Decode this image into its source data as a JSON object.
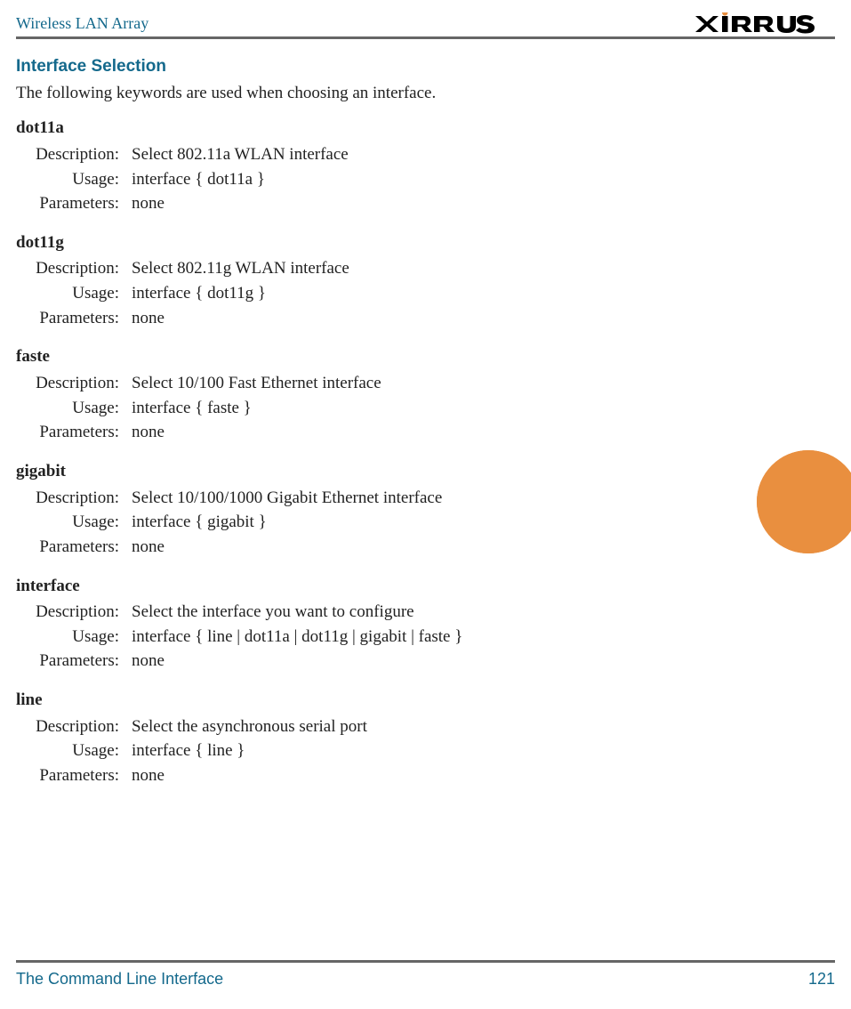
{
  "header": {
    "title": "Wireless LAN Array",
    "brand": "XIRRUS"
  },
  "section": {
    "heading": "Interface Selection",
    "intro": "The following keywords are used when choosing an interface."
  },
  "labels": {
    "description": "Description:",
    "usage": "Usage:",
    "parameters": "Parameters:"
  },
  "keywords": [
    {
      "name": "dot11a",
      "description": "Select 802.11a WLAN interface",
      "usage": "interface { dot11a }",
      "parameters": "none"
    },
    {
      "name": "dot11g",
      "description": "Select 802.11g WLAN interface",
      "usage": "interface { dot11g }",
      "parameters": "none"
    },
    {
      "name": "faste",
      "description": "Select 10/100 Fast Ethernet interface",
      "usage": "interface { faste }",
      "parameters": "none"
    },
    {
      "name": "gigabit",
      "description": "Select 10/100/1000 Gigabit Ethernet interface",
      "usage": "interface { gigabit }",
      "parameters": "none"
    },
    {
      "name": "interface",
      "description": "Select the interface you want to configure",
      "usage": "interface { line  |  dot11a  |  dot11g  |  gigabit  |  faste }",
      "parameters": "none"
    },
    {
      "name": "line",
      "description": "Select the asynchronous serial port",
      "usage": "interface { line }",
      "parameters": "none"
    }
  ],
  "footer": {
    "chapter": "The Command Line Interface",
    "page": "121"
  }
}
